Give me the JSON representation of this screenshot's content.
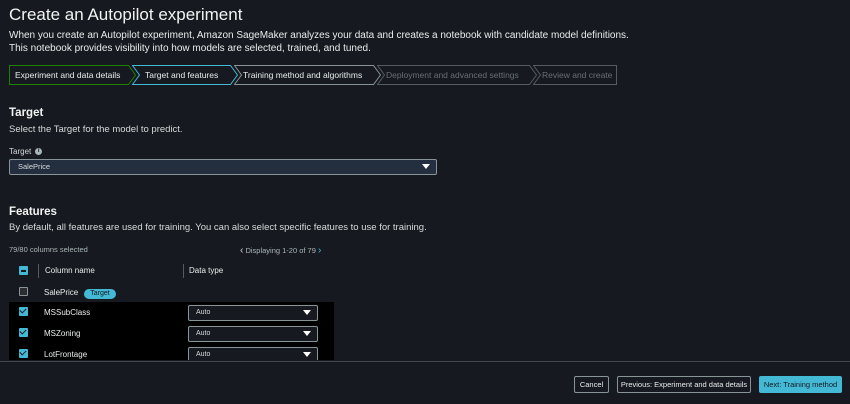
{
  "page": {
    "title": "Create an Autopilot experiment",
    "description_line1": "When you create an Autopilot experiment, Amazon SageMaker analyzes your data and creates a notebook with candidate model definitions.",
    "description_line2": "This notebook provides visibility into how models are selected, trained, and tuned."
  },
  "steps": [
    {
      "label": "Experiment and data details",
      "state": "completed"
    },
    {
      "label": "Target and features",
      "state": "current"
    },
    {
      "label": "Training method and algorithms",
      "state": "upcoming"
    },
    {
      "label": "Deployment and advanced settings",
      "state": "disabled"
    },
    {
      "label": "Review and create",
      "state": "disabled"
    }
  ],
  "target_section": {
    "heading": "Target",
    "subtext": "Select the Target for the model to predict.",
    "field_label": "Target",
    "info_icon_text": "i",
    "selected_value": "SalePrice"
  },
  "features_section": {
    "heading": "Features",
    "subtext": "By default, all features are used for training. You can also select specific features to use for training.",
    "columns_selected": "79/80 columns selected",
    "pagination": "Displaying 1-20 of 79",
    "table_headers": {
      "column_name": "Column name",
      "data_type": "Data type"
    },
    "rows": [
      {
        "name": "SalePrice",
        "checked": false,
        "badge": "Target",
        "data_type": ""
      },
      {
        "name": "MSSubClass",
        "checked": true,
        "badge": "",
        "data_type": "Auto"
      },
      {
        "name": "MSZoning",
        "checked": true,
        "badge": "",
        "data_type": "Auto"
      },
      {
        "name": "LotFrontage",
        "checked": true,
        "badge": "",
        "data_type": "Auto"
      }
    ]
  },
  "footer": {
    "cancel": "Cancel",
    "previous": "Previous: Experiment and data details",
    "next": "Next: Training method"
  },
  "colors": {
    "background": "#16191f",
    "accent": "#44b9d6",
    "step_completed_border": "#1d8102",
    "step_current_border": "#44b9d6",
    "step_upcoming_border": "#879596",
    "step_disabled_border": "#545b64"
  },
  "icons": {
    "info": "info-icon",
    "dropdown": "caret-down-icon",
    "prev_page": "chevron-left-icon",
    "next_page": "chevron-right-icon",
    "checkbox": "checkbox-icon"
  }
}
